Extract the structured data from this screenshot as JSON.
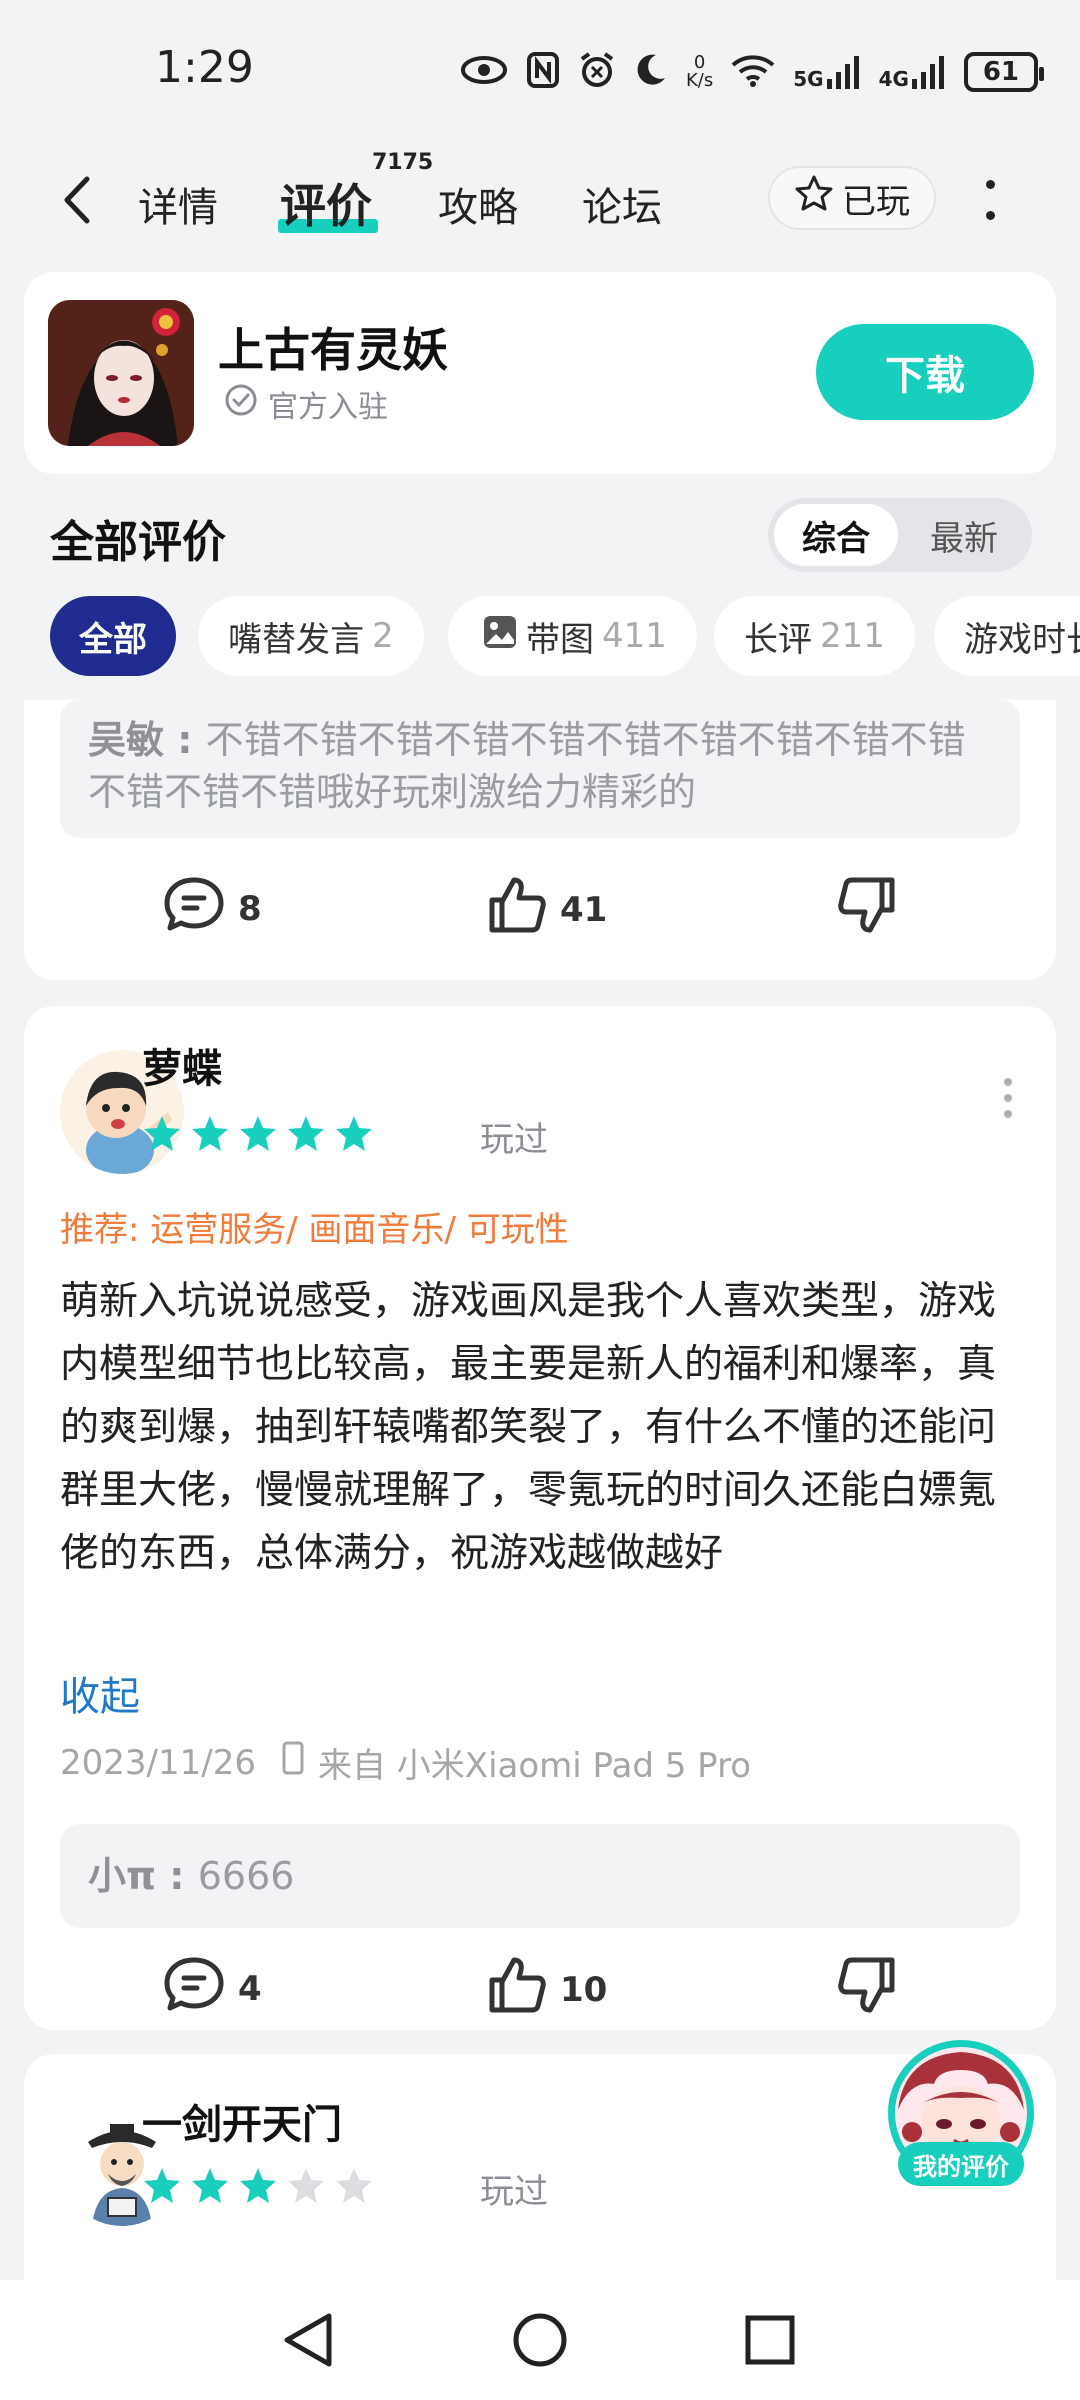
{
  "status_bar": {
    "time": "1:29",
    "net_speed_top": "0",
    "net_speed_unit": "K/s",
    "sig1": "5G",
    "sig2": "4G",
    "battery": "61"
  },
  "header": {
    "tabs": [
      "详情",
      "评价",
      "攻略",
      "论坛"
    ],
    "active_tab": "评价",
    "review_count": "7175",
    "played_label": "已玩"
  },
  "game": {
    "name": "上古有灵妖",
    "official_label": "官方入驻",
    "download_label": "下载"
  },
  "reviews_section": {
    "title": "全部评价",
    "sort_options": [
      "综合",
      "最新"
    ],
    "active_sort": "综合",
    "filters": [
      {
        "label": "全部",
        "count": ""
      },
      {
        "label": "嘴替发言",
        "count": "2"
      },
      {
        "label": "带图",
        "count": "411"
      },
      {
        "label": "长评",
        "count": "211"
      },
      {
        "label": "游戏时长",
        "count": ""
      }
    ]
  },
  "reviews": [
    {
      "reply": {
        "author": "吴敏",
        "sep": " : ",
        "text": "不错不错不错不错不错不错不错不错不错不错不错不错不错哦好玩刺激给力精彩的"
      },
      "comments": "8",
      "likes": "41"
    },
    {
      "username": "萝蝶",
      "rating": 5,
      "played_tag": "玩过",
      "recommend": "推荐: 运营服务/ 画面音乐/ 可玩性",
      "text": "萌新入坑说说感受，游戏画风是我个人喜欢类型，游戏内模型细节也比较高，最主要是新人的福利和爆率，真的爽到爆，抽到轩辕嘴都笑裂了，有什么不懂的还能问群里大佬，慢慢就理解了，零氪玩的时间久还能白嫖氪佬的东西，总体满分，祝游戏越做越好",
      "collapse_label": "收起",
      "date": "2023/11/26",
      "device": "来自 小米Xiaomi Pad 5 Pro",
      "reply": {
        "author": "小π",
        "sep": " : ",
        "text": "6666"
      },
      "comments": "4",
      "likes": "10"
    },
    {
      "username": "一剑开天门",
      "rating": 3,
      "played_tag": "玩过"
    }
  ],
  "floating": {
    "my_review_label": "我的评价"
  },
  "colors": {
    "accent": "#17cfbc",
    "chip_active": "#1f2b8f",
    "recommend": "#f07b3a",
    "link": "#1f78c8"
  }
}
